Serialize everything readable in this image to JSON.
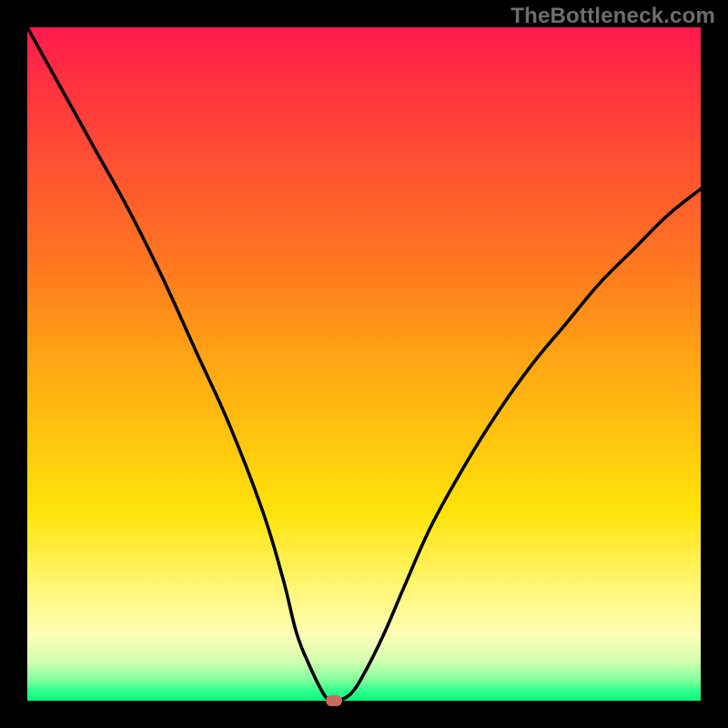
{
  "watermark": "TheBottleneck.com",
  "chart_data": {
    "type": "line",
    "title": "",
    "xlabel": "",
    "ylabel": "",
    "xlim": [
      0,
      100
    ],
    "ylim": [
      0,
      100
    ],
    "grid": false,
    "legend": false,
    "gradient_stops": [
      {
        "pct": 0,
        "color": "#ff1a4d"
      },
      {
        "pct": 12,
        "color": "#ff3b3b"
      },
      {
        "pct": 24,
        "color": "#ff5a2e"
      },
      {
        "pct": 36,
        "color": "#ff7a1f"
      },
      {
        "pct": 48,
        "color": "#ffa115"
      },
      {
        "pct": 60,
        "color": "#ffc20f"
      },
      {
        "pct": 72,
        "color": "#ffe30a"
      },
      {
        "pct": 82,
        "color": "#fff56a"
      },
      {
        "pct": 90,
        "color": "#fffdb5"
      },
      {
        "pct": 94,
        "color": "#d6ffb0"
      },
      {
        "pct": 97,
        "color": "#7fff9e"
      },
      {
        "pct": 98.5,
        "color": "#2fff8e"
      },
      {
        "pct": 100,
        "color": "#08ff7a"
      }
    ],
    "series": [
      {
        "name": "bottleneck-curve",
        "x": [
          0,
          5,
          10,
          15,
          20,
          25,
          30,
          35,
          38,
          40,
          42,
          44,
          45,
          46,
          48,
          50,
          53,
          56,
          60,
          65,
          70,
          75,
          80,
          85,
          90,
          95,
          100
        ],
        "y": [
          100,
          91,
          82,
          73,
          63,
          52,
          41,
          28,
          18,
          10,
          5,
          1,
          0,
          0,
          1,
          4,
          10,
          17,
          26,
          35,
          43,
          50,
          56,
          62,
          67,
          72,
          76
        ]
      }
    ],
    "marker": {
      "x": 45.5,
      "y": 0,
      "color": "#c66a5f"
    },
    "minimum_flat_range_x": [
      44,
      47
    ]
  }
}
